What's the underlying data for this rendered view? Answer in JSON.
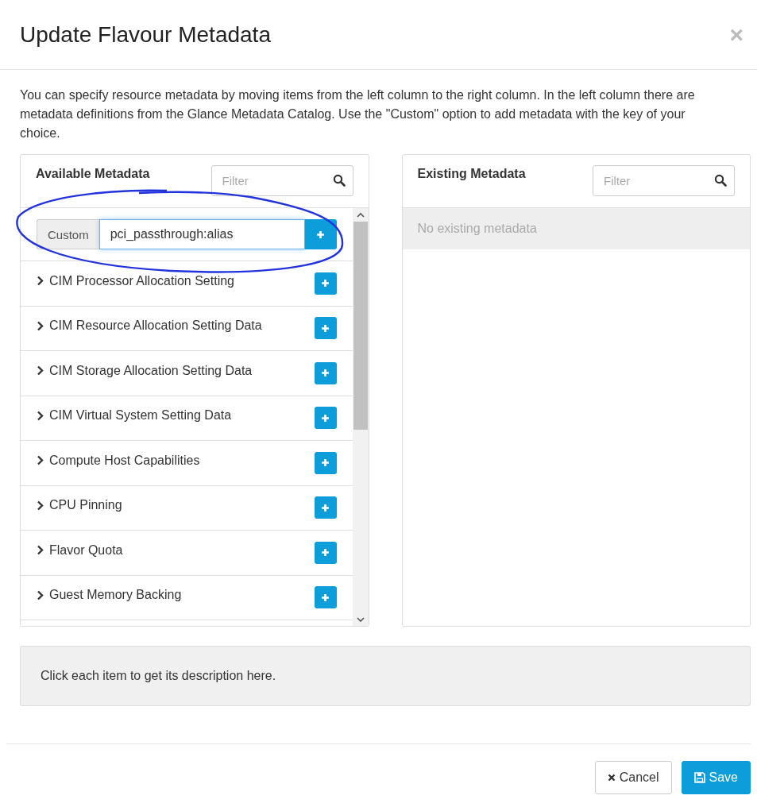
{
  "dialog": {
    "title": "Update Flavour Metadata",
    "close": "×"
  },
  "intro": "You can specify resource metadata by moving items from the left column to the right column. In the left column there are metadata definitions from the Glance Metadata Catalog. Use the \"Custom\" option to add metadata with the key of your choice.",
  "available": {
    "title": "Available Metadata",
    "filter_placeholder": "Filter",
    "custom": {
      "label": "Custom",
      "value": "pci_passthrough:alias",
      "focused": true
    },
    "items": [
      {
        "label": "CIM Processor Allocation Setting",
        "expanded": false
      },
      {
        "label": "CIM Resource Allocation Setting Data",
        "expanded": false
      },
      {
        "label": "CIM Storage Allocation Setting Data",
        "expanded": false
      },
      {
        "label": "CIM Virtual System Setting Data",
        "expanded": false
      },
      {
        "label": "Compute Host Capabilities",
        "expanded": false
      },
      {
        "label": "CPU Pinning",
        "expanded": false
      },
      {
        "label": "Flavor Quota",
        "expanded": false
      },
      {
        "label": "Guest Memory Backing",
        "expanded": false
      }
    ]
  },
  "existing": {
    "title": "Existing Metadata",
    "filter_placeholder": "Filter",
    "empty_text": "No existing metadata"
  },
  "description": "Click each item to get its description here.",
  "buttons": [
    {
      "kind": "cancel",
      "label": "Cancel"
    },
    {
      "kind": "save",
      "label": "Save"
    }
  ]
}
